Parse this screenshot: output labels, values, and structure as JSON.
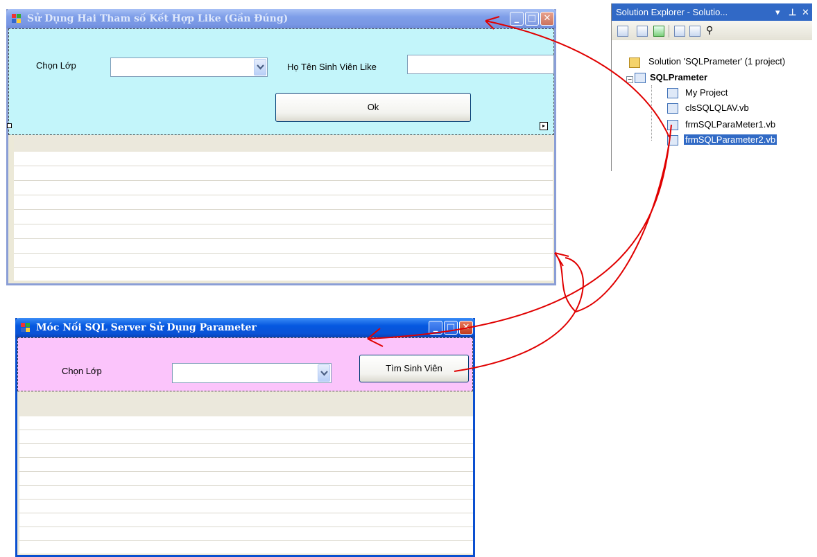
{
  "form_like": {
    "title": "Sử Dụng Hai Tham số Kết Hợp Like (Gần Đúng)",
    "class_label": "Chọn Lớp",
    "class_combo_value": "",
    "name_label": "Họ Tên Sinh Viên Like",
    "name_input_value": "",
    "ok_button": "Ok",
    "panel_color": "#c3f5fa",
    "grid_rows": 9
  },
  "form_param": {
    "title": "Móc Nối SQL Server Sử Dụng Parameter",
    "class_label": "Chọn Lớp",
    "class_combo_value": "",
    "search_button": "Tìm Sinh Viên",
    "panel_color": "#fbc4fb",
    "grid_rows": 10
  },
  "solution_explorer": {
    "title": "Solution Explorer - Solutio...",
    "pin_icon": "pin-icon",
    "close_icon": "close-icon",
    "tree": {
      "solution": "Solution 'SQLPrameter' (1 project)",
      "project": "SQLPrameter",
      "items": [
        "My Project",
        "clsSQLQLAV.vb",
        "frmSQLParaMeter1.vb",
        "frmSQLParameter2.vb"
      ],
      "selected": "frmSQLParameter2.vb"
    }
  },
  "annotation_color": "#e00000"
}
